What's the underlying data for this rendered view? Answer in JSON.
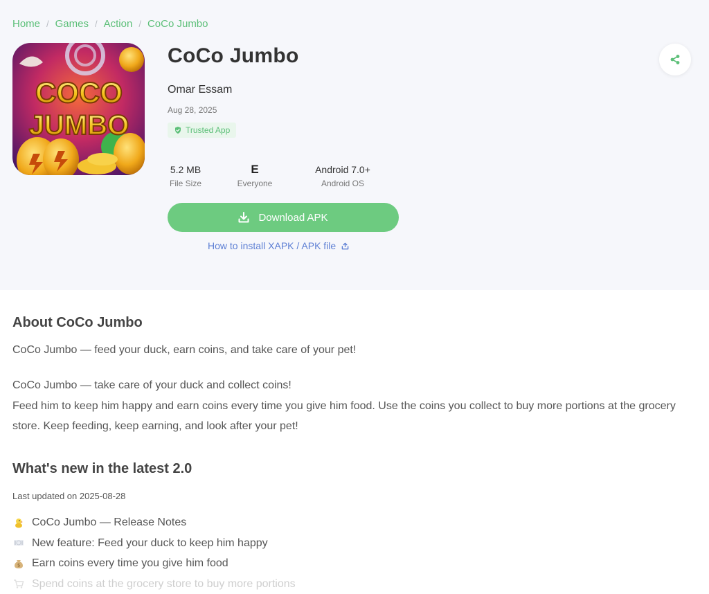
{
  "breadcrumb": {
    "items": [
      "Home",
      "Games",
      "Action",
      "CoCo Jumbo"
    ],
    "separator": "/"
  },
  "app": {
    "title": "CoCo Jumbo",
    "developer": "Omar Essam",
    "date": "Aug 28, 2025",
    "badge": "Trusted App",
    "icon_text": [
      "COCO",
      "JUMBO"
    ]
  },
  "stats": [
    {
      "value": "5.2 MB",
      "label": "File Size"
    },
    {
      "value": "E",
      "label": "Everyone",
      "icon": "esrb-e-icon"
    },
    {
      "value": "Android 7.0+",
      "label": "Android OS"
    }
  ],
  "download": {
    "label": "Download APK",
    "icon": "download-icon"
  },
  "howto": {
    "label": "How to install XAPK / APK file",
    "icon": "external-link-icon"
  },
  "share": {
    "icon": "share-icon"
  },
  "about": {
    "heading": "About CoCo Jumbo",
    "p1": "CoCo Jumbo — feed your duck, earn coins, and take care of your pet!",
    "p2_line1": "CoCo Jumbo — take care of your duck and collect coins!",
    "p2_line2": "Feed him to keep him happy and earn coins every time you give him food. Use the coins you collect to buy more portions at the grocery store. Keep feeding, keep earning, and look after your pet!"
  },
  "whats_new": {
    "heading": "What's new in the latest 2.0",
    "updated": "Last updated on 2025-08-28",
    "notes": [
      {
        "icon": "chick-icon",
        "text": "CoCo Jumbo — Release Notes"
      },
      {
        "icon": "plate-icon",
        "text": "New feature: Feed your duck to keep him happy"
      },
      {
        "icon": "money-bag-icon",
        "text": "Earn coins every time you give him food"
      },
      {
        "icon": "cart-icon",
        "text": "Spend coins at the grocery store to buy more portions"
      }
    ]
  },
  "colors": {
    "accent": "#6dcb80",
    "link": "#5d7fd4",
    "top_bg": "#f6f7fb",
    "text": "#333333"
  }
}
